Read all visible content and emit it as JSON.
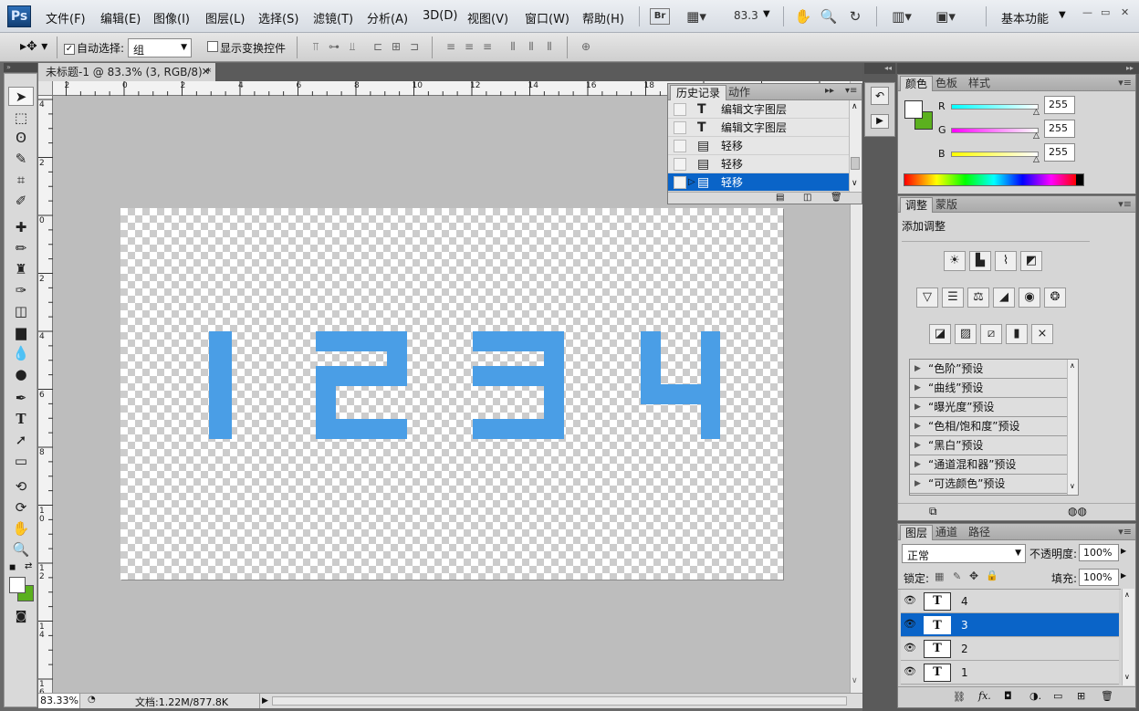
{
  "app": {
    "logo": "Ps"
  },
  "menu": [
    "文件(F)",
    "编辑(E)",
    "图像(I)",
    "图层(L)",
    "选择(S)",
    "滤镜(T)",
    "分析(A)",
    "3D(D)",
    "视图(V)",
    "窗口(W)",
    "帮助(H)"
  ],
  "appbar": {
    "bridge_label": "Br",
    "zoom": "83.3",
    "workspace": "基本功能"
  },
  "window_controls": [
    "—",
    "▭",
    "✕"
  ],
  "options": {
    "auto_select_label": "自动选择:",
    "auto_select_checked": true,
    "auto_select_value": "组",
    "show_transform_label": "显示变换控件",
    "show_transform_checked": false
  },
  "document": {
    "tab_title": "未标题-1 @ 83.3% (3, RGB/8) *",
    "canvas_text": [
      "1",
      "2",
      "3",
      "4"
    ],
    "text_color": "#4a9ee6"
  },
  "ruler": {
    "top": [
      "2",
      "0",
      "2",
      "4",
      "6",
      "8",
      "10",
      "12",
      "14",
      "16",
      "18"
    ],
    "left": [
      "4",
      "2",
      "0",
      "2",
      "4",
      "6",
      "8",
      "10",
      "12",
      "14",
      "16"
    ]
  },
  "status": {
    "zoom": "83.33%",
    "doc_info": "文档:1.22M/877.8K"
  },
  "history": {
    "tabs": [
      "历史记录",
      "动作"
    ],
    "items": [
      {
        "icon": "T",
        "label": "编辑文字图层",
        "selected": false
      },
      {
        "icon": "T",
        "label": "编辑文字图层",
        "selected": false
      },
      {
        "icon": "▤",
        "label": "轻移",
        "selected": false
      },
      {
        "icon": "▤",
        "label": "轻移",
        "selected": false
      },
      {
        "icon": "▤",
        "label": "轻移",
        "selected": true
      }
    ]
  },
  "color_panel": {
    "tabs": [
      "颜色",
      "色板",
      "样式"
    ],
    "channels": [
      {
        "name": "R",
        "value": "255"
      },
      {
        "name": "G",
        "value": "255"
      },
      {
        "name": "B",
        "value": "255"
      }
    ],
    "foreground": "#ffffff",
    "background": "#5bb01e"
  },
  "adjustments": {
    "tabs": [
      "调整",
      "蒙版"
    ],
    "title": "添加调整",
    "presets": [
      "“色阶”预设",
      "“曲线”预设",
      "“曝光度”预设",
      "“色相/饱和度”预设",
      "“黑白”预设",
      "“通道混和器”预设",
      "“可选颜色”预设"
    ]
  },
  "layers": {
    "tabs": [
      "图层",
      "通道",
      "路径"
    ],
    "blend_mode": "正常",
    "opacity_label": "不透明度:",
    "opacity": "100%",
    "lock_label": "锁定:",
    "fill_label": "填充:",
    "fill": "100%",
    "items": [
      {
        "name": "4",
        "selected": false
      },
      {
        "name": "3",
        "selected": true
      },
      {
        "name": "2",
        "selected": false
      },
      {
        "name": "1",
        "selected": false
      }
    ]
  }
}
